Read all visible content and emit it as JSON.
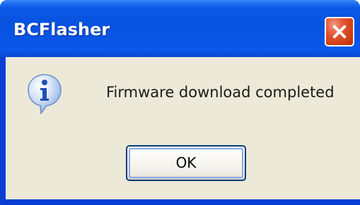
{
  "window": {
    "title": "BCFlasher"
  },
  "dialog": {
    "icon": "information-icon",
    "message": "Firmware download completed"
  },
  "buttons": {
    "close_icon": "close-icon",
    "ok_label": "OK"
  },
  "colors": {
    "titlebar": "#0752e0",
    "close_button": "#d6451c",
    "client_background": "#ece9d8",
    "button_border": "#003c74"
  }
}
